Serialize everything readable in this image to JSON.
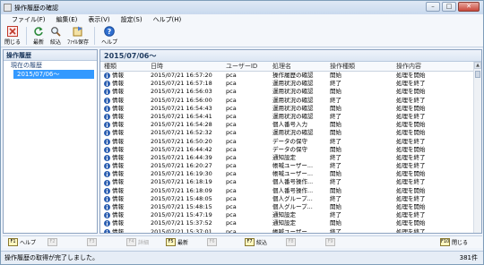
{
  "window": {
    "title": "操作履歴の確認"
  },
  "menu": [
    "ファイル(F)",
    "編集(E)",
    "表示(V)",
    "設定(S)",
    "ヘルプ(H)"
  ],
  "toolbar": {
    "close_label": "閉じる",
    "refresh_label": "最新",
    "filter_label": "絞込",
    "save_label": "ﾌｧｲﾙ保存",
    "help_label": "ヘルプ"
  },
  "left_panel": {
    "title": "操作履歴",
    "tree": {
      "current": "現在の履歴",
      "selected": "2015/07/06～"
    }
  },
  "right_panel": {
    "title": "2015/07/06～",
    "columns": [
      "種類",
      "日時",
      "ユーザーID",
      "処理名",
      "操作種類",
      "操作内容"
    ],
    "rows": [
      {
        "type": "情報",
        "datetime": "2015/07/21 16:57:20",
        "user": "pca",
        "name": "操作履歴の確認",
        "op": "開始",
        "detail": "処理を開始"
      },
      {
        "type": "情報",
        "datetime": "2015/07/21 16:57:18",
        "user": "pca",
        "name": "運用状況の確認",
        "op": "終了",
        "detail": "処理を終了"
      },
      {
        "type": "情報",
        "datetime": "2015/07/21 16:56:03",
        "user": "pca",
        "name": "運用状況の確認",
        "op": "開始",
        "detail": "処理を開始"
      },
      {
        "type": "情報",
        "datetime": "2015/07/21 16:56:00",
        "user": "pca",
        "name": "運用状況の確認",
        "op": "終了",
        "detail": "処理を終了"
      },
      {
        "type": "情報",
        "datetime": "2015/07/21 16:54:43",
        "user": "pca",
        "name": "運用状況の確認",
        "op": "開始",
        "detail": "処理を開始"
      },
      {
        "type": "情報",
        "datetime": "2015/07/21 16:54:41",
        "user": "pca",
        "name": "運用状況の確認",
        "op": "終了",
        "detail": "処理を終了"
      },
      {
        "type": "情報",
        "datetime": "2015/07/21 16:54:28",
        "user": "pca",
        "name": "個人番号入力",
        "op": "開始",
        "detail": "処理を開始"
      },
      {
        "type": "情報",
        "datetime": "2015/07/21 16:52:32",
        "user": "pca",
        "name": "運用状況の確認",
        "op": "開始",
        "detail": "処理を開始"
      },
      {
        "type": "情報",
        "datetime": "2015/07/21 16:50:20",
        "user": "pca",
        "name": "データの保守",
        "op": "終了",
        "detail": "処理を終了"
      },
      {
        "type": "情報",
        "datetime": "2015/07/21 16:44:42",
        "user": "pca",
        "name": "データの保守",
        "op": "開始",
        "detail": "処理を開始"
      },
      {
        "type": "情報",
        "datetime": "2015/07/21 16:44:39",
        "user": "pca",
        "name": "通知設定",
        "op": "終了",
        "detail": "処理を終了"
      },
      {
        "type": "情報",
        "datetime": "2015/07/21 16:20:27",
        "user": "pca",
        "name": "帳喊ユーザー...",
        "op": "終了",
        "detail": "処理を終了"
      },
      {
        "type": "情報",
        "datetime": "2015/07/21 16:19:30",
        "user": "pca",
        "name": "帳喊ユーザー...",
        "op": "開始",
        "detail": "処理を開始"
      },
      {
        "type": "情報",
        "datetime": "2015/07/21 16:18:19",
        "user": "pca",
        "name": "個人番号操作...",
        "op": "終了",
        "detail": "処理を終了"
      },
      {
        "type": "情報",
        "datetime": "2015/07/21 16:18:09",
        "user": "pca",
        "name": "個人番号操作...",
        "op": "開始",
        "detail": "処理を開始"
      },
      {
        "type": "情報",
        "datetime": "2015/07/21 15:48:05",
        "user": "pca",
        "name": "個人グループ...",
        "op": "終了",
        "detail": "処理を終了"
      },
      {
        "type": "情報",
        "datetime": "2015/07/21 15:48:15",
        "user": "pca",
        "name": "個人グループ...",
        "op": "開始",
        "detail": "処理を開始"
      },
      {
        "type": "情報",
        "datetime": "2015/07/21 15:47:19",
        "user": "pca",
        "name": "通知設定",
        "op": "終了",
        "detail": "処理を終了"
      },
      {
        "type": "情報",
        "datetime": "2015/07/21 15:37:52",
        "user": "pca",
        "name": "通知設定",
        "op": "開始",
        "detail": "処理を開始"
      },
      {
        "type": "情報",
        "datetime": "2015/07/21 15:37:01",
        "user": "pca",
        "name": "帳喊ユーザー...",
        "op": "終了",
        "detail": "処理を終了"
      }
    ]
  },
  "fkeys": [
    {
      "key": "F1",
      "label": "ヘルプ",
      "enabled": true
    },
    {
      "key": "F2",
      "label": "",
      "enabled": false
    },
    {
      "key": "F3",
      "label": "",
      "enabled": false
    },
    {
      "key": "F4",
      "label": "詳細",
      "enabled": false
    },
    {
      "key": "F5",
      "label": "最新",
      "enabled": true
    },
    {
      "key": "F6",
      "label": "",
      "enabled": false
    },
    {
      "key": "F7",
      "label": "絞込",
      "enabled": true
    },
    {
      "key": "F8",
      "label": "",
      "enabled": false
    },
    {
      "key": "F9",
      "label": "",
      "enabled": false
    },
    {
      "key": "F10",
      "label": "閉じる",
      "enabled": true
    }
  ],
  "status": {
    "message": "操作履歴の取得が完了しました。",
    "count": "381件"
  },
  "colors": {
    "accent": "#3399ff",
    "info_icon": "#2a5db0",
    "header_text": "#1e3a5f"
  }
}
